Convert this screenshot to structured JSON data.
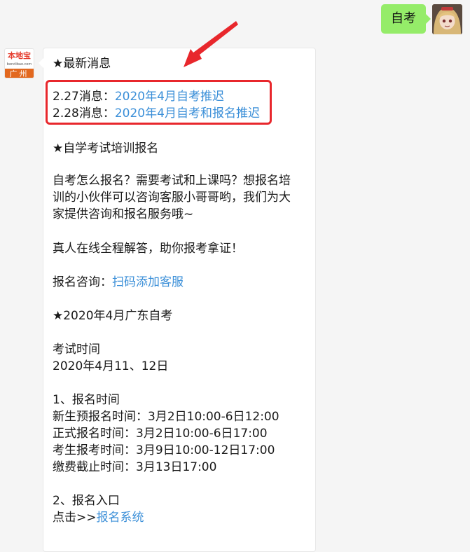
{
  "user_message": {
    "text": "自考"
  },
  "bot": {
    "avatar": {
      "brand": "本地宝",
      "domain": "bendibao.com",
      "city": "广州"
    },
    "lines": {
      "latest_header": "★最新消息",
      "news1_prefix": "2.27消息：",
      "news1_link": "2020年4月自考推迟",
      "news2_prefix": "2.28消息：",
      "news2_link": "2020年4月自考和报名推迟",
      "training_header": "★自学考试培训报名",
      "para1_l1": "自考怎么报名？需要考试和上课吗？想报名培",
      "para1_l2": "训的小伙伴可以咨询客服小哥哥哟，我们为大",
      "para1_l3": "家提供咨询和报名服务哦~",
      "para2": "真人在线全程解答，助你报考拿证！",
      "consult_prefix": "报名咨询：",
      "consult_link": "扫码添加客服",
      "gd_header": "★2020年4月广东自考",
      "exam_time_label": "考试时间",
      "exam_time_value": "2020年4月11、12日",
      "section1_title": "1、报名时间",
      "s1_l1": "新生预报名时间：3月2日10:00-6日12:00",
      "s1_l2": "正式报名时间：3月2日10:00-6日17:00",
      "s1_l3": "考生报考时间：3月9日10:00-12日17:00",
      "s1_l4": "缴费截止时间：3月13日17:00",
      "section2_title": "2、报名入口",
      "entry_prefix": "点击>>",
      "entry_link": "报名系统"
    }
  },
  "colors": {
    "link": "#3b8fd8",
    "highlight": "#e8272c",
    "user_bubble": "#95ec69"
  }
}
